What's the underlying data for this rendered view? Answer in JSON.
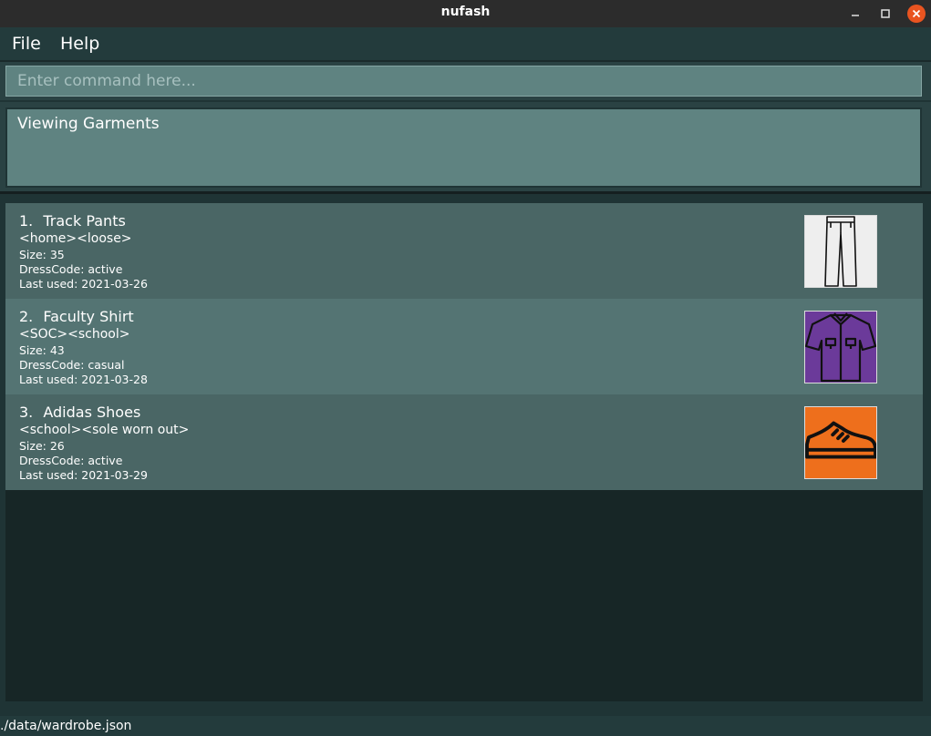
{
  "window": {
    "title": "nufash"
  },
  "menu": {
    "file": "File",
    "help": "Help"
  },
  "command": {
    "placeholder": "Enter command here...",
    "value": ""
  },
  "result": {
    "text": "Viewing Garments"
  },
  "garments": [
    {
      "index": "1.",
      "name": "Track Pants",
      "tags": "<home><loose>",
      "size": "Size: 35",
      "dresscode": "DressCode: active",
      "last_used": "Last used: 2021-03-26",
      "icon": "pants-icon",
      "icon_bg": "#eeeeee"
    },
    {
      "index": "2.",
      "name": "Faculty Shirt",
      "tags": "<SOC><school>",
      "size": "Size: 43",
      "dresscode": "DressCode: casual",
      "last_used": "Last used: 2021-03-28",
      "icon": "shirt-icon",
      "icon_bg": "#6b3a9a"
    },
    {
      "index": "3.",
      "name": "Adidas Shoes",
      "tags": "<school><sole worn out>",
      "size": "Size: 26",
      "dresscode": "DressCode: active",
      "last_used": "Last used: 2021-03-29",
      "icon": "shoe-icon",
      "icon_bg": "#ee6f1c"
    }
  ],
  "status": {
    "path": "./data/wardrobe.json"
  }
}
